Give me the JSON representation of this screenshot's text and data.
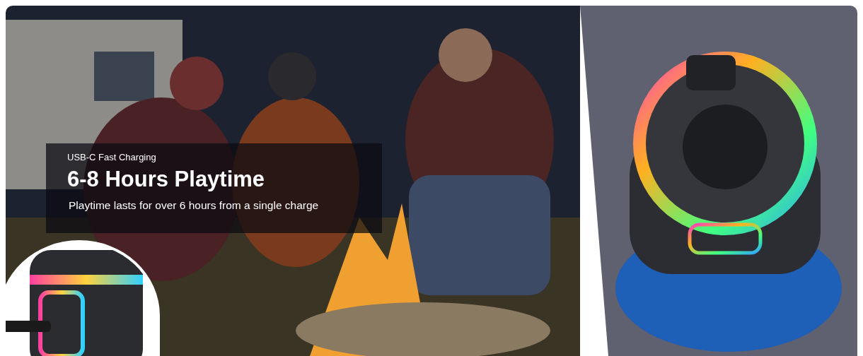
{
  "banner": {
    "eyebrow": "USB-C Fast Charging",
    "headline": "6-8 Hours Playtime",
    "description": "Playtime lasts for over 6 hours from a single charge"
  }
}
